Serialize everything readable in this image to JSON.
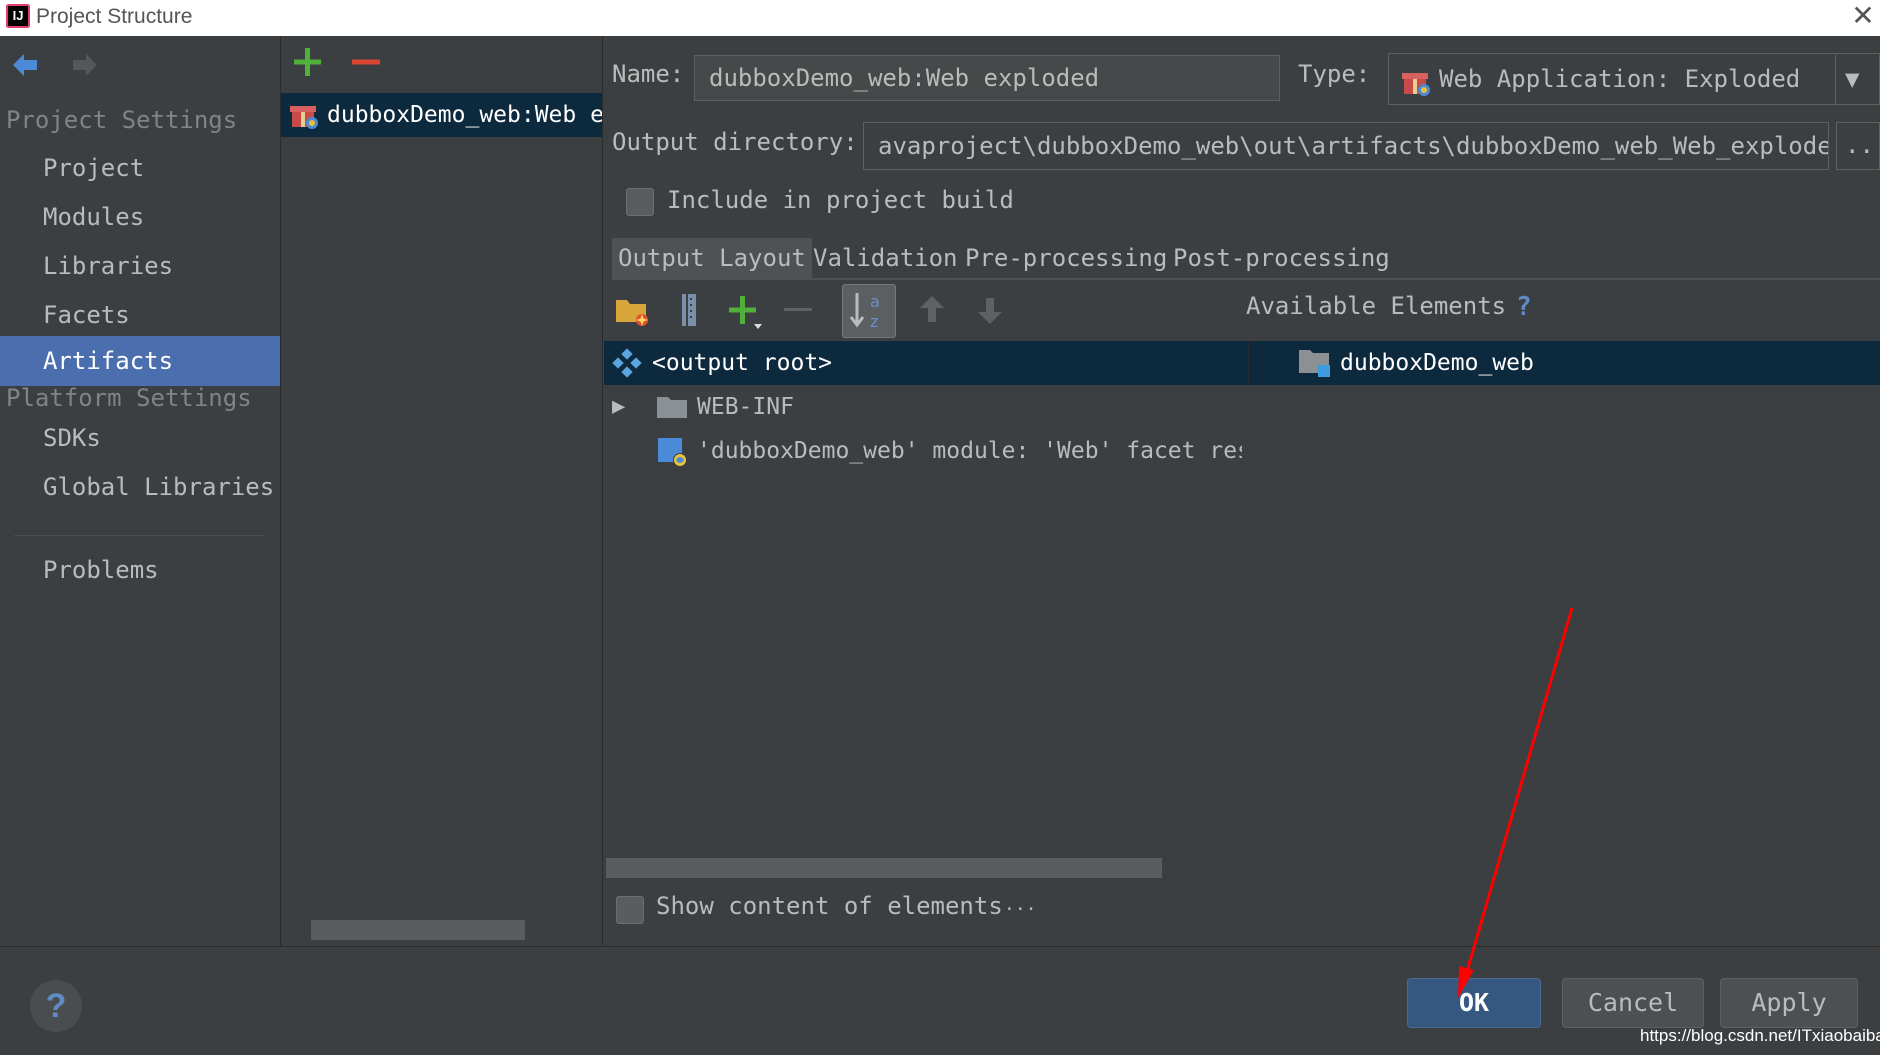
{
  "window": {
    "title": "Project Structure",
    "app_icon_label": "IJ"
  },
  "sidebar": {
    "project_settings_title": "Project Settings",
    "project_items": [
      {
        "label": "Project",
        "selected": false
      },
      {
        "label": "Modules",
        "selected": false
      },
      {
        "label": "Libraries",
        "selected": false
      },
      {
        "label": "Facets",
        "selected": false
      },
      {
        "label": "Artifacts",
        "selected": true
      }
    ],
    "platform_settings_title": "Platform Settings",
    "platform_items": [
      {
        "label": "SDKs"
      },
      {
        "label": "Global Libraries"
      }
    ],
    "problems_label": "Problems"
  },
  "artifact_list": {
    "items": [
      {
        "label": "dubboxDemo_web:Web exploded"
      }
    ]
  },
  "artifact": {
    "name_label": "Name:",
    "name_value": "dubboxDemo_web:Web exploded",
    "type_label": "Type:",
    "type_value": "Web Application: Exploded",
    "output_dir_label": "Output directory:",
    "output_dir_value": "avaproject\\dubboxDemo_web\\out\\artifacts\\dubboxDemo_web_Web_exploded",
    "browse_label": "...",
    "include_build_label": "Include in project build",
    "include_build_checked": false
  },
  "tabs": [
    {
      "label": "Output Layout",
      "active": true
    },
    {
      "label": "Validation",
      "active": false
    },
    {
      "label": "Pre-processing",
      "active": false
    },
    {
      "label": "Post-processing",
      "active": false
    }
  ],
  "layout": {
    "available_elements_label": "Available Elements",
    "help_mark": "?",
    "tree": [
      {
        "label": "<output root>",
        "icon": "output-root-icon",
        "selected": true
      },
      {
        "label": "WEB-INF",
        "icon": "folder-icon",
        "expandable": true
      },
      {
        "label": "'dubboxDemo_web' module: 'Web' facet res",
        "icon": "web-facet-icon"
      }
    ],
    "available": [
      {
        "label": "dubboxDemo_web",
        "icon": "module-folder-icon"
      }
    ],
    "show_content_label": "Show content of elements",
    "show_content_extra": "...",
    "show_content_checked": false
  },
  "footer": {
    "help": "?",
    "ok_label": "OK",
    "cancel_label": "Cancel",
    "apply_label": "Apply",
    "watermark": "https://blog.csdn.net/ITxiaobaibai"
  },
  "colors": {
    "background": "#3c3f41",
    "selection": "#4b6eaf",
    "tree_selection": "#0d293e",
    "ok_button": "#365880",
    "add_green": "#4fb13a",
    "remove_red": "#d9462f",
    "annotation_arrow": "#ff0000"
  }
}
